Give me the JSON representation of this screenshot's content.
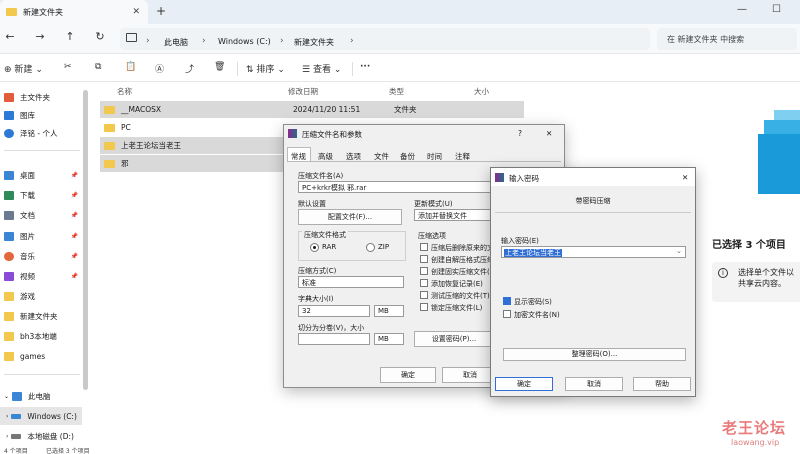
{
  "window": {
    "tab_title": "新建文件夹",
    "newtab_label": "+",
    "minimize": "—",
    "maximize": "☐"
  },
  "nav": {
    "breadcrumb": [
      "此电脑",
      "Windows (C:)",
      "新建文件夹"
    ],
    "search_placeholder": "在 新建文件夹 中搜索"
  },
  "toolbar": {
    "new_label": "新建",
    "sort_label": "排序",
    "view_label": "查看",
    "more_label": "···"
  },
  "sidebar": {
    "items": [
      {
        "label": "主文件夹",
        "icon": "home-icon",
        "color": "#e25b3a"
      },
      {
        "label": "图库",
        "icon": "gallery-icon",
        "color": "#2d7ad6"
      },
      {
        "label": "泽铭 - 个人",
        "icon": "cloud-icon",
        "color": "#2d7ad6"
      },
      {
        "label": "桌面",
        "icon": "desktop-icon",
        "color": "#3a86d4"
      },
      {
        "label": "下载",
        "icon": "download-icon",
        "color": "#2e8a57"
      },
      {
        "label": "文档",
        "icon": "document-icon",
        "color": "#6b7a8f"
      },
      {
        "label": "图片",
        "icon": "picture-icon",
        "color": "#3a86d4"
      },
      {
        "label": "音乐",
        "icon": "music-icon",
        "color": "#e2673a"
      },
      {
        "label": "视频",
        "icon": "video-icon",
        "color": "#8a4bd6"
      },
      {
        "label": "游戏",
        "icon": "folder-icon",
        "color": "#f2c94c"
      },
      {
        "label": "新建文件夹",
        "icon": "folder-icon",
        "color": "#f2c94c"
      },
      {
        "label": "bh3本地端",
        "icon": "folder-icon",
        "color": "#f2c94c"
      },
      {
        "label": "games",
        "icon": "folder-icon",
        "color": "#f2c94c"
      },
      {
        "label": "此电脑",
        "icon": "pc-icon",
        "color": "#3a86d4"
      },
      {
        "label": "Windows (C:)",
        "icon": "drive-icon",
        "color": "#3a86d4"
      },
      {
        "label": "本地磁盘 (D:)",
        "icon": "drive-icon",
        "color": "#777777"
      }
    ]
  },
  "filelist": {
    "headers": [
      "名称",
      "修改日期",
      "类型",
      "大小"
    ],
    "rows": [
      {
        "name": "__MACOSX",
        "date": "2024/11/20 11:51",
        "type": "文件夹",
        "selected": true
      },
      {
        "name": "PC",
        "date": "",
        "type": "",
        "selected": false
      },
      {
        "name": "上老王论坛当老王",
        "date": "",
        "type": "",
        "selected": true
      },
      {
        "name": "邪",
        "date": "",
        "type": "",
        "selected": true
      }
    ]
  },
  "details": {
    "selected_count": "已选择 3 个项目",
    "info_text": "选择单个文件以共享云内容。"
  },
  "status": {
    "item_count": "4 个项目",
    "selected": "已选择 3 个项目"
  },
  "archive_dialog": {
    "title": "压缩文件名和参数",
    "help": "?",
    "close": "✕",
    "tabs": [
      "常规",
      "高级",
      "选项",
      "文件",
      "备份",
      "时间",
      "注释"
    ],
    "archive_name_label": "压缩文件名(A)",
    "archive_name_value": "PC+krkr模拟 邪.rar",
    "default_settings_label": "默认设置",
    "profiles_button": "配置文件(F)...",
    "update_mode_label": "更新模式(U)",
    "update_mode_value": "添加并替换文件",
    "format_label": "压缩文件格式",
    "format_rar": "RAR",
    "format_zip": "ZIP",
    "options_label": "压缩选项",
    "options": [
      "压缩后删除原来的文",
      "创建自解压格式压缩",
      "创建固实压缩文件(S)",
      "添加恢复记录(E)",
      "测试压缩的文件(T)",
      "锁定压缩文件(L)"
    ],
    "method_label": "压缩方式(C)",
    "method_value": "标准",
    "dict_label": "字典大小(I)",
    "dict_value": "32",
    "dict_unit": "MB",
    "split_label": "切分为分卷(V)，大小",
    "split_unit": "MB",
    "password_button": "设置密码(P)...",
    "ok_button": "确定",
    "cancel_button": "取消"
  },
  "password_dialog": {
    "title": "输入密码",
    "close": "✕",
    "subtitle": "带密码压缩",
    "password_label": "输入密码(E)",
    "password_value": "上老王论坛当老王",
    "show_password": "显示密码(S)",
    "encrypt_names": "加密文件名(N)",
    "organize_button": "整理密码(O)...",
    "ok_button": "确定",
    "cancel_button": "取消",
    "help_button": "帮助"
  },
  "watermark": {
    "cn": "老王论坛",
    "url": "laowang.vip"
  }
}
